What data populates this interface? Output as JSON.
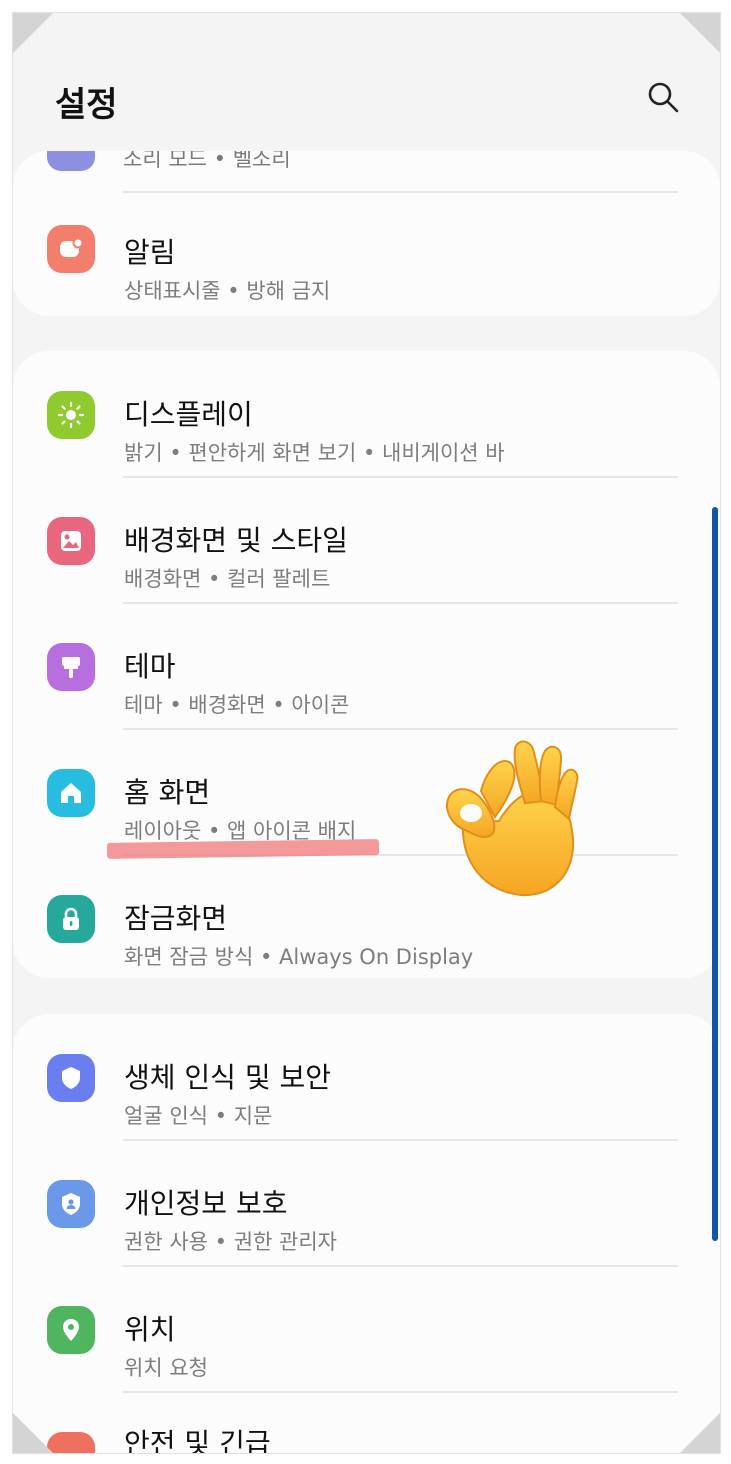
{
  "header": {
    "title": "설정"
  },
  "peek": {
    "subtitle": "소리 모드 • 벨소리"
  },
  "groups": [
    {
      "items": [
        {
          "title": "알림",
          "subtitle": "상태표시줄 • 방해 금지",
          "icon": "notification-icon",
          "color": "#f27e6b"
        }
      ]
    },
    {
      "items": [
        {
          "title": "디스플레이",
          "subtitle": "밝기 • 편안하게 화면 보기 • 내비게이션 바",
          "icon": "sun-icon",
          "color": "#8fcb2f"
        },
        {
          "title": "배경화면 및 스타일",
          "subtitle": "배경화면 • 컬러 팔레트",
          "icon": "image-icon",
          "color": "#e9667e"
        },
        {
          "title": "테마",
          "subtitle": "테마 • 배경화면 • 아이콘",
          "icon": "paint-brush-icon",
          "color": "#b76fe0"
        },
        {
          "title": "홈 화면",
          "subtitle": "레이아웃 • 앱 아이콘 배지",
          "icon": "home-icon",
          "color": "#27bde0"
        },
        {
          "title": "잠금화면",
          "subtitle": "화면 잠금 방식 • Always On Display",
          "icon": "lock-icon",
          "color": "#26a99a"
        }
      ]
    },
    {
      "items": [
        {
          "title": "생체 인식 및 보안",
          "subtitle": "얼굴 인식 • 지문",
          "icon": "shield-icon",
          "color": "#6b7ef0"
        },
        {
          "title": "개인정보 보호",
          "subtitle": "권한 사용 • 권한 관리자",
          "icon": "privacy-shield-icon",
          "color": "#6b98e8"
        },
        {
          "title": "위치",
          "subtitle": "위치 요청",
          "icon": "location-pin-icon",
          "color": "#4fb55f"
        },
        {
          "title": "안전 및 긴급",
          "subtitle": "",
          "icon": "emergency-icon",
          "color": "#f0705f"
        }
      ]
    }
  ],
  "annotations": {
    "emoji": "ok-hand-emoji",
    "highlight_color": "#f08080"
  }
}
